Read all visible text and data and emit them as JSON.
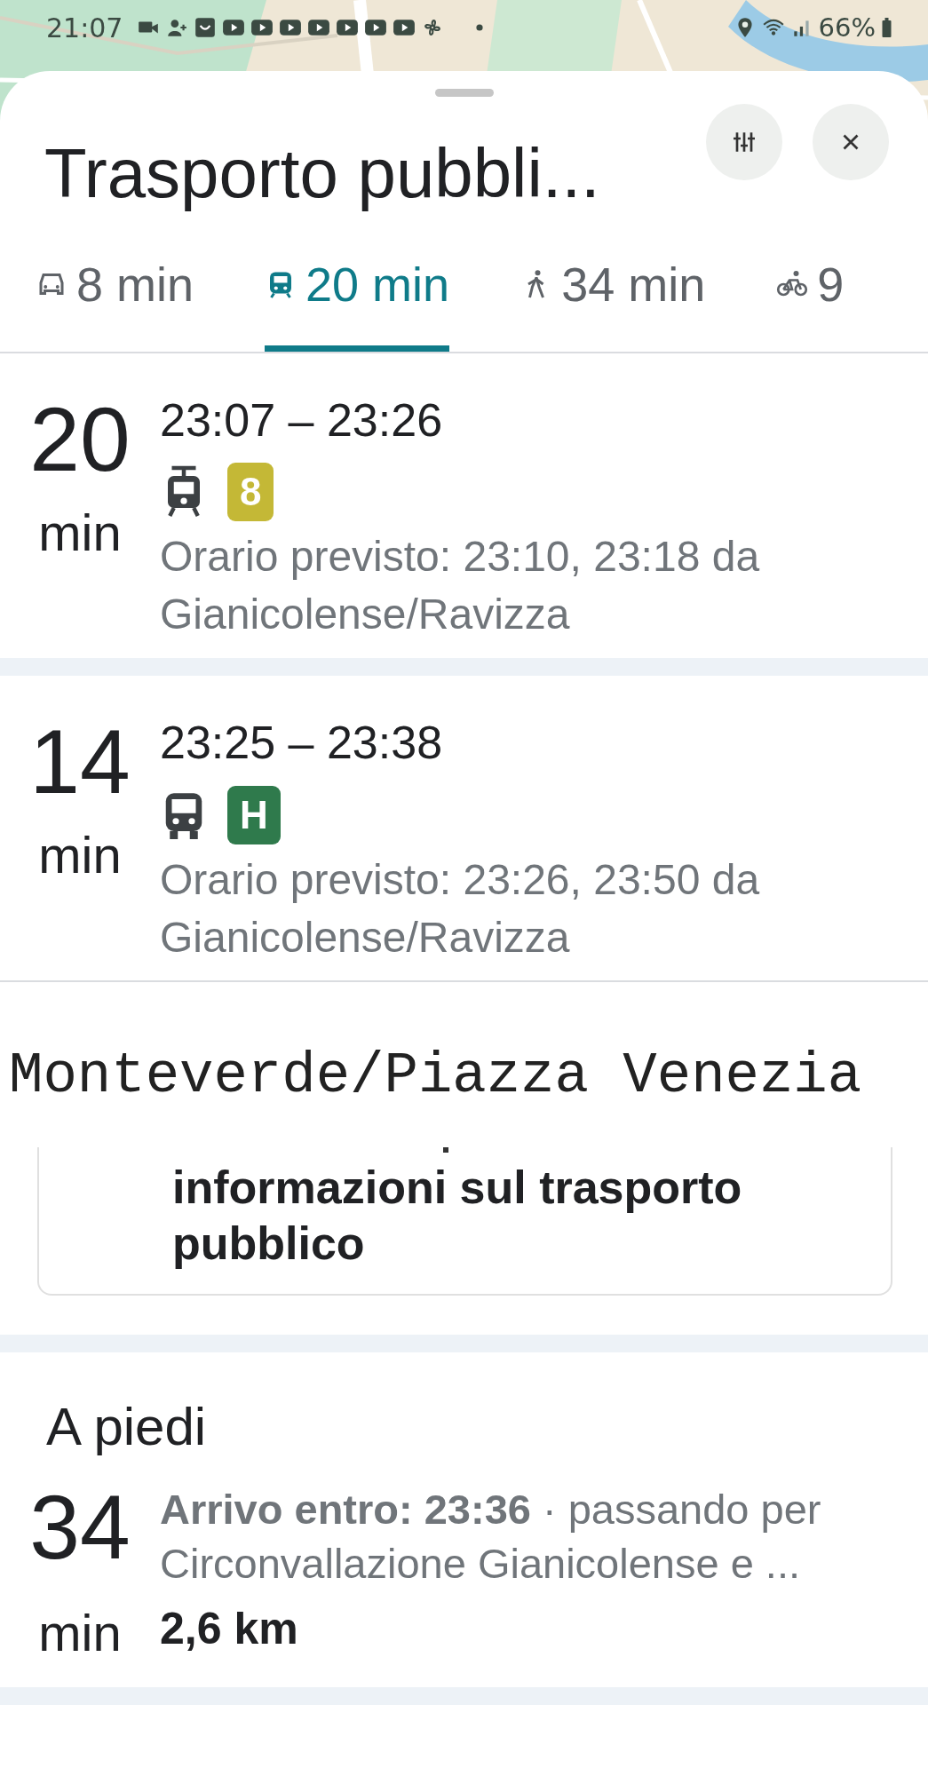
{
  "status_bar": {
    "time": "21:07",
    "battery": "66%"
  },
  "header": {
    "title": "Trasporto pubbli..."
  },
  "tabs": [
    {
      "kind": "car",
      "label": "8 min",
      "selected": false
    },
    {
      "kind": "transit",
      "label": "20 min",
      "selected": true
    },
    {
      "kind": "walk",
      "label": "34 min",
      "selected": false
    },
    {
      "kind": "bike",
      "label": "9",
      "selected": false
    }
  ],
  "routes": [
    {
      "duration": "20",
      "unit": "min",
      "times": "23:07 – 23:26",
      "kind": "tram",
      "line": "8",
      "color": "#c4b836",
      "schedule": "Orario previsto: 23:10, 23:18 da Gianicolense/Ravizza"
    },
    {
      "duration": "14",
      "unit": "min",
      "times": "23:25 – 23:38",
      "kind": "bus",
      "line": "H",
      "color": "#2f7a4c",
      "schedule": "Orario previsto: 23:26, 23:50 da Gianicolense/Ravizza"
    }
  ],
  "overlay_text": "Monteverde/Piazza Venezia",
  "info_card": {
    "text": "informazioni sul trasporto pubblico"
  },
  "walking": {
    "heading": "A piedi",
    "duration": "34",
    "unit": "min",
    "summary": "**Arrivo entro: 23:36** · passando per Circonvallazione Gianicolense e ...",
    "distance": "2,6 km"
  }
}
